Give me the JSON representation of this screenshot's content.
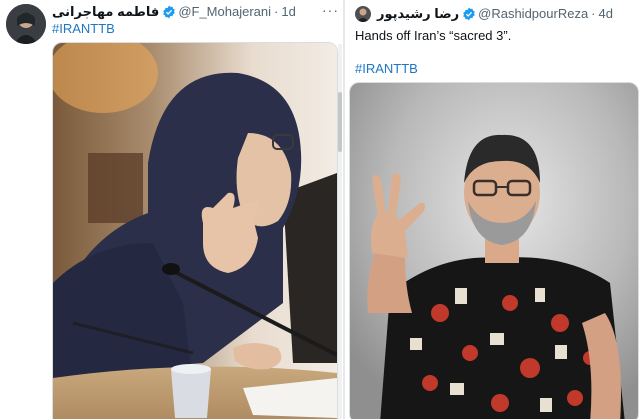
{
  "tweets": [
    {
      "author_name": "فاطمه مهاجرانی",
      "handle": "@F_Mohajerani",
      "separator": "·",
      "time": "1d",
      "text": "",
      "hashtag": "#IRANTTB",
      "more_icon": "more-icon"
    },
    {
      "author_name": "رضا رشیدپور",
      "handle": "@RashidpourReza",
      "separator": "·",
      "time": "4d",
      "text": "Hands off Iran’s “sacred 3”.",
      "hashtag": "#IRANTTB",
      "more_icon": "more-icon"
    }
  ],
  "colors": {
    "link": "#1d77c4",
    "verified": "#1d9bf0",
    "muted": "#536471"
  },
  "icons": [
    "verified-badge-icon",
    "more-options-icon"
  ]
}
